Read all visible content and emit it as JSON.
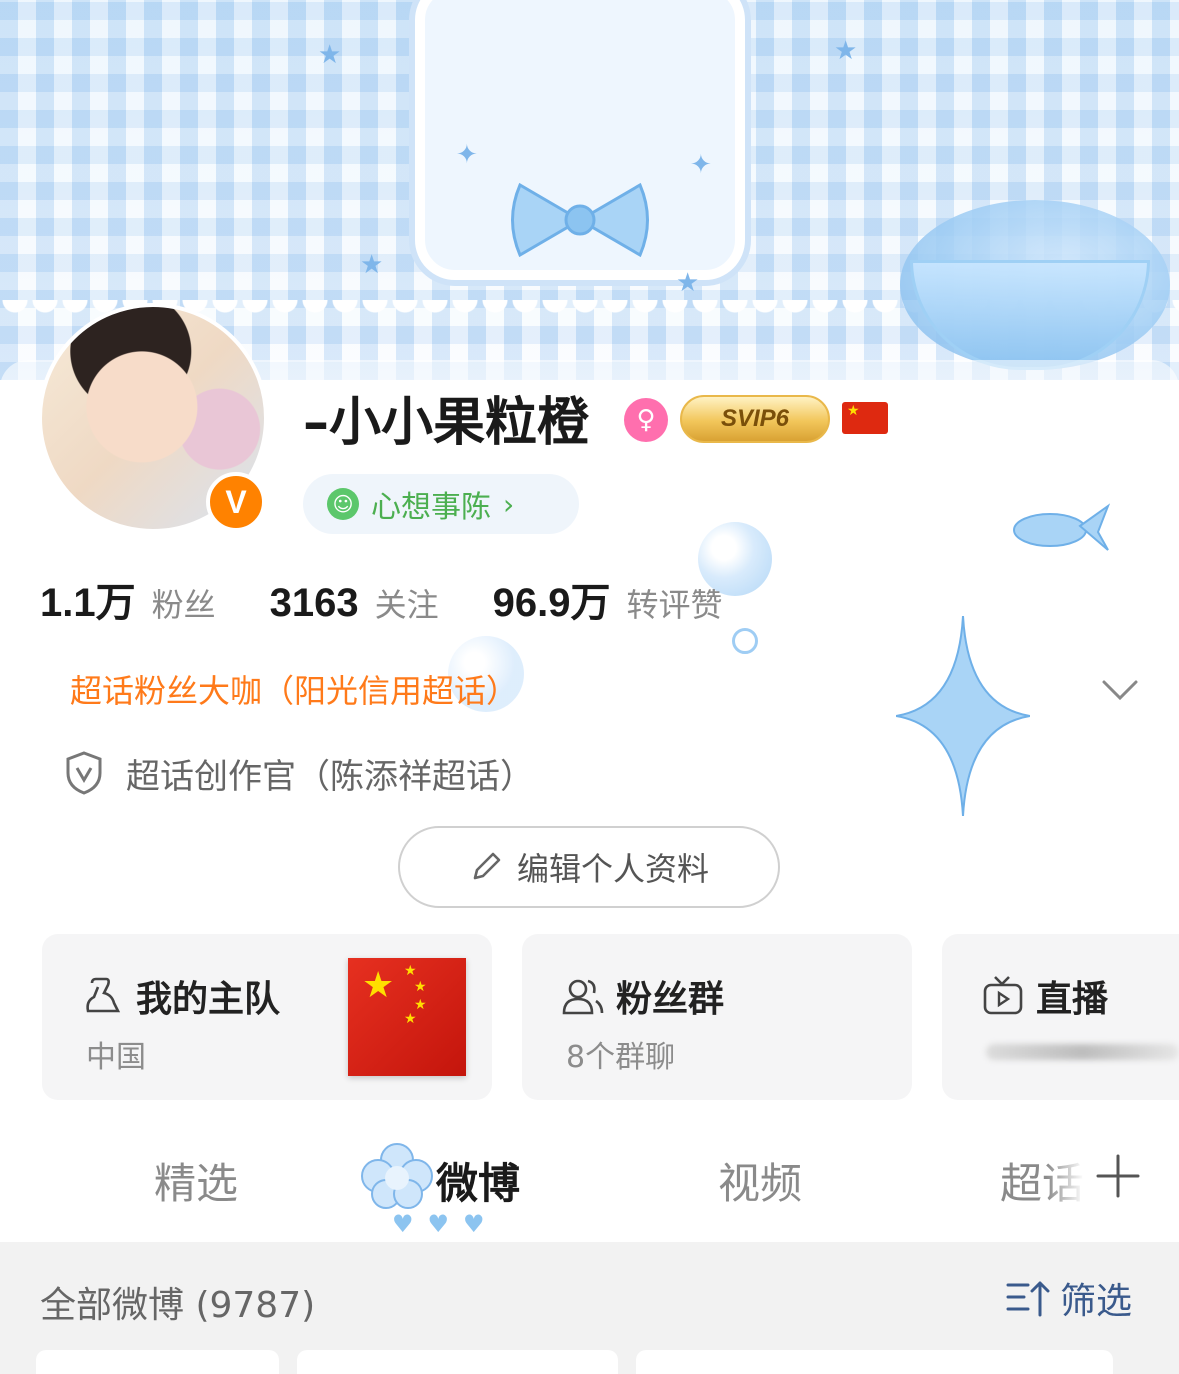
{
  "profile": {
    "username": "–小小果粒橙",
    "gender_symbol": "♀",
    "vip_label": "SVIP6",
    "verified_mark": "V",
    "mood": "心想事陈",
    "mood_chevron": "›"
  },
  "stats": [
    {
      "value": "1.1万",
      "label": "粉丝"
    },
    {
      "value": "3163",
      "label": "关注"
    },
    {
      "value": "96.9万",
      "label": "转评赞"
    }
  ],
  "tags": {
    "super_fan": "超话粉丝大咖（阳光信用超话）",
    "creator": "超话创作官（陈添祥超话）"
  },
  "edit_profile_label": "编辑个人资料",
  "feature_cards": [
    {
      "title": "我的主队",
      "subtitle": "中国",
      "icon": "team-icon"
    },
    {
      "title": "粉丝群",
      "subtitle": "8个群聊",
      "icon": "group-icon"
    },
    {
      "title": "直播",
      "subtitle": "",
      "icon": "tv-icon"
    }
  ],
  "tabs": [
    {
      "label": "精选"
    },
    {
      "label": "微博"
    },
    {
      "label": "视频"
    },
    {
      "label": "超话"
    }
  ],
  "feed": {
    "title": "全部微博 (9787)",
    "filter_label": "筛选"
  },
  "colors": {
    "accent_orange": "#ff8200",
    "tag_orange": "#ff7a1a",
    "mood_green": "#4caf50",
    "filter_blue": "#3a5a8c"
  }
}
